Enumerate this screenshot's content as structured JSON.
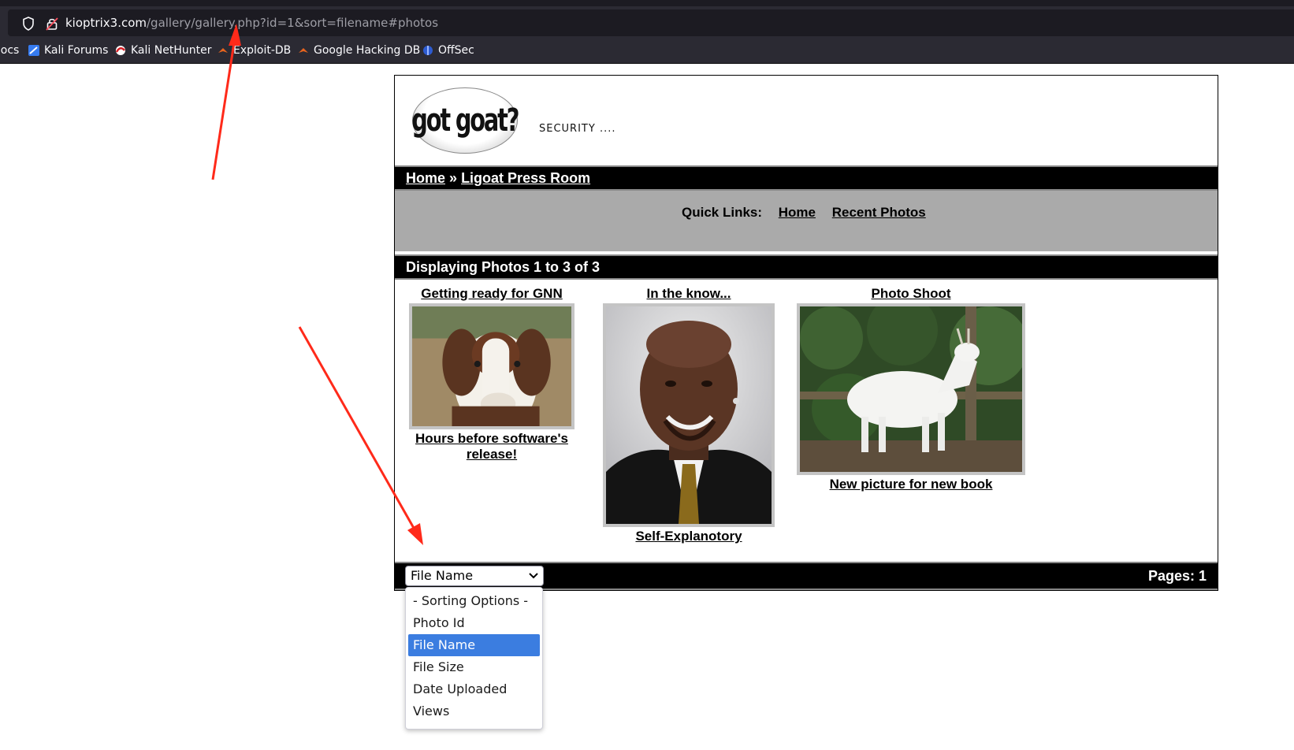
{
  "browser": {
    "url_domain": "kioptrix3.com",
    "url_path": "/gallery/gallery.php?id=1&sort=filename#photos",
    "bookmarks": [
      {
        "label": "Docs",
        "icon": "doc-icon"
      },
      {
        "label": "Kali Forums",
        "icon": "kali-forums-icon"
      },
      {
        "label": "Kali NetHunter",
        "icon": "nethunter-icon"
      },
      {
        "label": "Exploit-DB",
        "icon": "exploitdb-icon"
      },
      {
        "label": "Google Hacking DB",
        "icon": "ghdb-icon"
      },
      {
        "label": "OffSec",
        "icon": "offsec-icon"
      }
    ]
  },
  "site": {
    "logo_text": "got goat?",
    "tagline": "SECURITY ...."
  },
  "breadcrumb": {
    "home": "Home",
    "separator": "»",
    "current": "Ligoat Press Room"
  },
  "quick_links": {
    "label": "Quick Links:",
    "home": "Home",
    "recent": "Recent Photos"
  },
  "display_bar": {
    "text": "Displaying Photos 1 to 3 of 3"
  },
  "photos": [
    {
      "title": "Getting ready for GNN",
      "caption_line1": "Hours before software's",
      "caption_line2": "release!",
      "image": "goat-closeup"
    },
    {
      "title": "In the know...",
      "caption_line1": "Self-Explanotory",
      "caption_line2": "",
      "image": "man-portrait"
    },
    {
      "title": "Photo Shoot",
      "caption_line1": "New picture for new book",
      "caption_line2": "",
      "image": "white-goat"
    }
  ],
  "footer": {
    "sort_selected": "File Name",
    "pages_label": "Pages: 1"
  },
  "sort_options": [
    "- Sorting Options -",
    "Photo Id",
    "File Name",
    "File Size",
    "Date Uploaded",
    "Views"
  ],
  "sort_selected_index": 2,
  "colors": {
    "chrome_bg": "#2b2a33",
    "bar_bg": "#000000",
    "quick_bg": "#aaaaaa",
    "highlight": "#3b7de0",
    "arrow": "#ff2a1a"
  }
}
